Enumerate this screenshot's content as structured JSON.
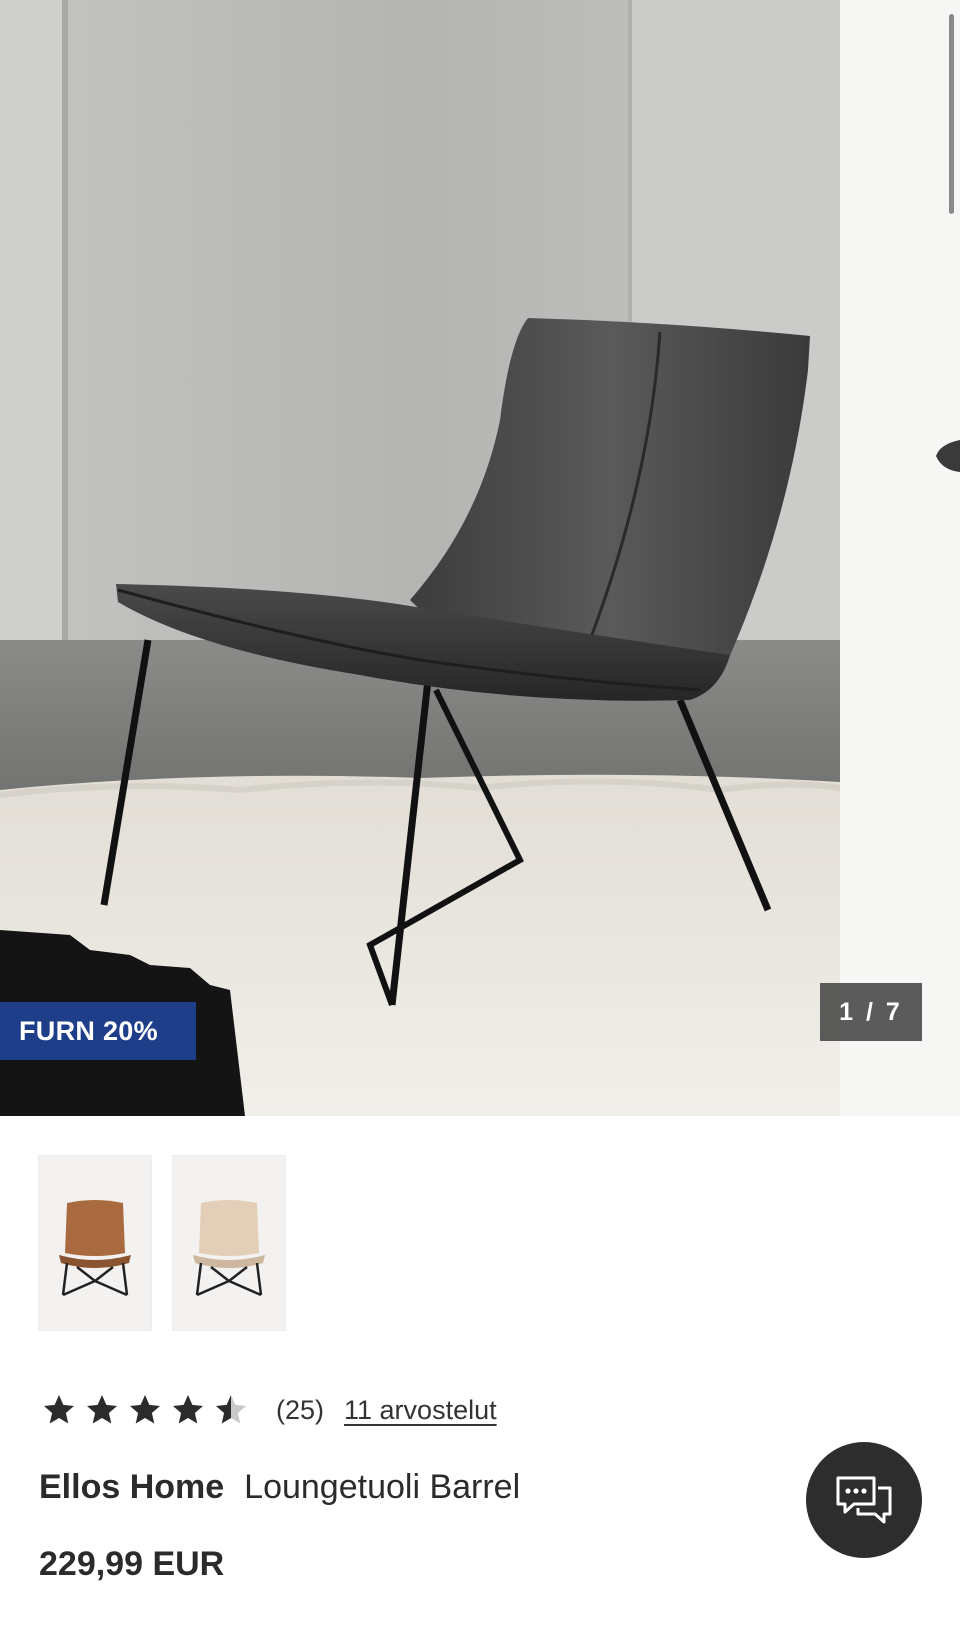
{
  "gallery": {
    "badge": "FURN 20%",
    "counter": "1 / 7",
    "hero_alt": "Black leather lounge chair on white shag rug",
    "variants": [
      {
        "color_name": "cognac",
        "seat_color": "#a86a3e"
      },
      {
        "color_name": "beige",
        "seat_color": "#e3cfb8"
      }
    ]
  },
  "rating": {
    "value": 4.5,
    "max": 5,
    "count": "(25)",
    "reviews_link": "11 arvostelut"
  },
  "product": {
    "brand": "Ellos Home",
    "name": "Loungetuoli Barrel",
    "price": "229,99 EUR"
  },
  "chat": {
    "icon": "chat-bubbles-icon"
  },
  "colors": {
    "badge_bg": "#1f3e8a",
    "chat_bg": "#2d2d2d",
    "text": "#2b2b2b"
  }
}
